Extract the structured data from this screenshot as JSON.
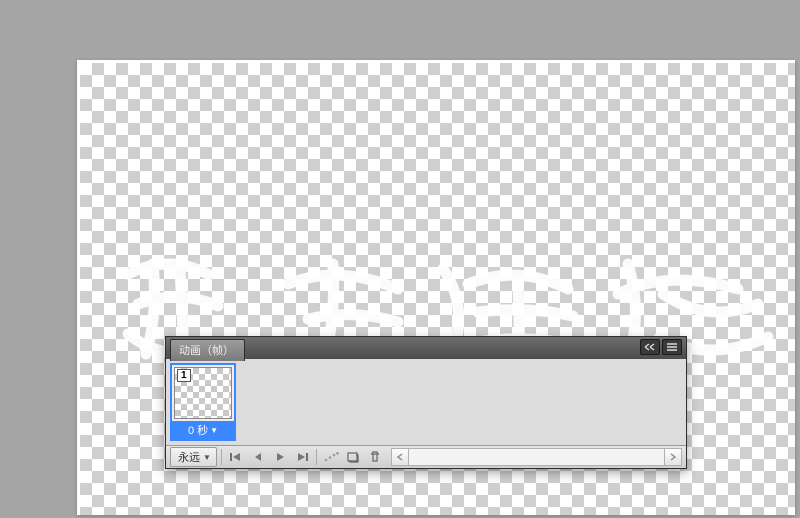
{
  "panel": {
    "title": "动画（帧）"
  },
  "frames": [
    {
      "index": "1",
      "delay": "0 秒"
    }
  ],
  "footer": {
    "loop_label": "永远"
  },
  "icons": {
    "collapse": "collapse-icon",
    "menu": "menu-icon",
    "first_frame": "first-frame-icon",
    "prev_frame": "prev-frame-icon",
    "play": "play-icon",
    "next_frame": "next-frame-icon",
    "tween": "tween-icon",
    "new_frame": "new-frame-icon",
    "delete_frame": "delete-frame-icon"
  }
}
